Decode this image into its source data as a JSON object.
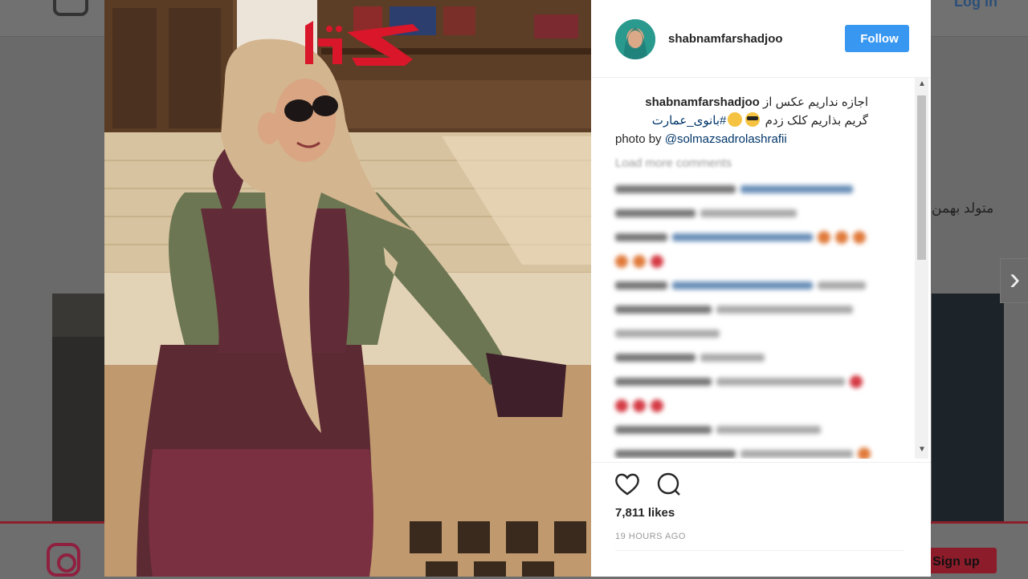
{
  "background": {
    "header_login": "Log in",
    "side_text": "متولد بهمن",
    "signup_label": "Sign up"
  },
  "post": {
    "username": "shabnamfarshadjoo",
    "follow_label": "Follow",
    "caption_user": "shabnamfarshadjoo",
    "caption_line1": "اجازه نداریم عکس از",
    "caption_line2": "گریم بذاریم کلک زدم",
    "caption_hashtag": "#بانوی_عمارت",
    "caption_credit_prefix": "photo by",
    "caption_mention": "@solmazsadrolashrafii",
    "load_more": "Load more comments",
    "likes": "7,811 likes",
    "timestamp": "19 HOURS AGO"
  },
  "colors": {
    "follow_blue": "#3897f0",
    "logo_red": "#d9162a",
    "link_blue": "#003569"
  },
  "icons": [
    "heart-icon",
    "comment-icon",
    "chevron-right-icon",
    "instagram-icon"
  ]
}
